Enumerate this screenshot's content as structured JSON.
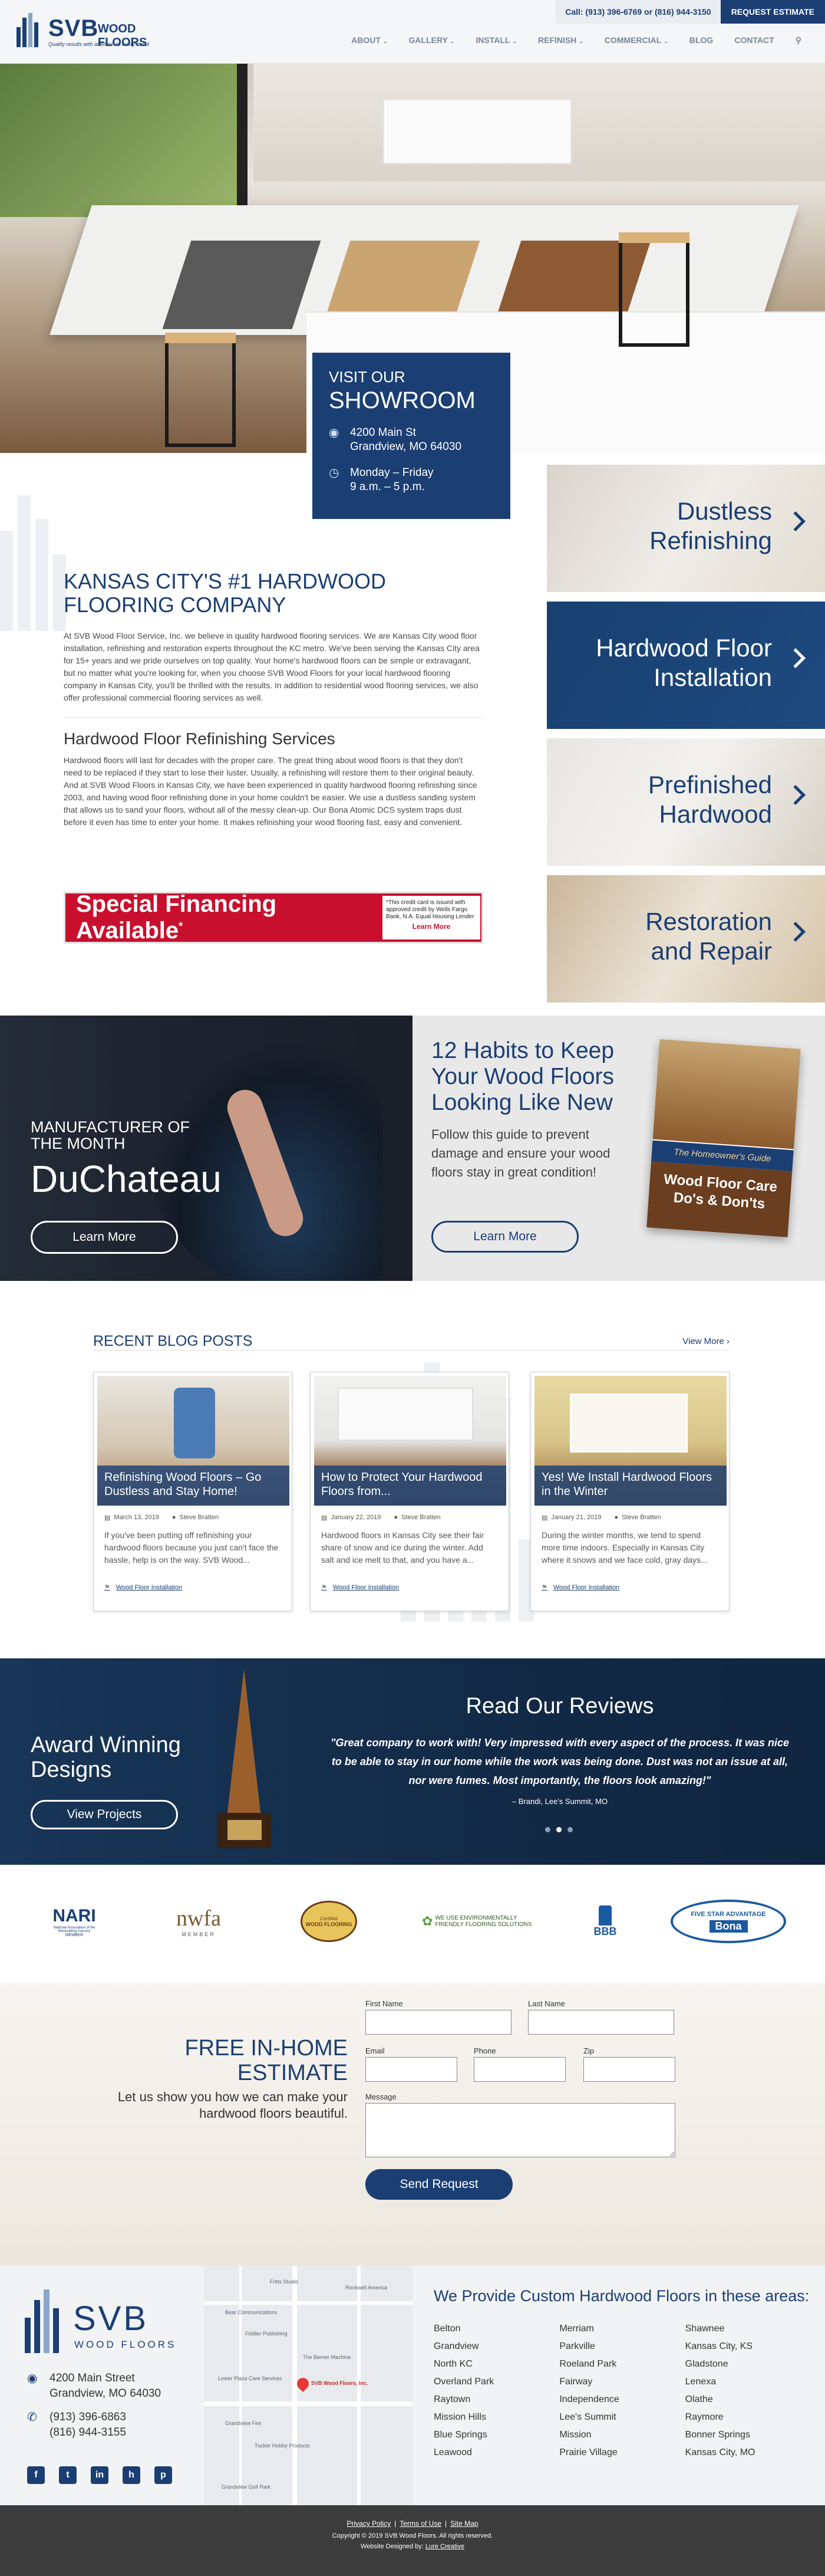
{
  "header": {
    "logo_brand": "SVB",
    "logo_brand2": "WOOD FLOORS",
    "logo_tagline": "Quality results with attention to every detail",
    "phone": "Call: (913) 396-6769 or (816) 944-3150",
    "request_button": "REQUEST ESTIMATE",
    "nav": [
      "ABOUT",
      "GALLERY",
      "INSTALL",
      "REFINISH",
      "COMMERCIAL",
      "BLOG",
      "CONTACT"
    ],
    "nav_dropdowns": [
      true,
      true,
      true,
      true,
      true,
      false,
      false
    ]
  },
  "showroom": {
    "visit": "VISIT OUR",
    "title": "SHOWROOM",
    "address_1": "4200 Main St",
    "address_2": "Grandview, MO 64030",
    "hours_1": "Monday – Friday",
    "hours_2": "9 a.m. – 5 p.m."
  },
  "services": [
    {
      "line1": "Dustless",
      "line2": "Refinishing",
      "color": "#1b3f73"
    },
    {
      "line1": "Hardwood Floor",
      "line2": "Installation",
      "color": "#ffffff"
    },
    {
      "line1": "Prefinished",
      "line2": "Hardwood",
      "color": "#1b3f73"
    },
    {
      "line1": "Restoration",
      "line2": "and Repair",
      "color": "#1b3f73"
    }
  ],
  "intro": {
    "title": "KANSAS CITY'S #1 HARDWOOD FLOORING COMPANY",
    "body": "At SVB Wood Floor Service, Inc. we believe in quality hardwood flooring services. We are Kansas City wood floor installation, refinishing and restoration experts throughout the KC metro. We've been serving the Kansas City area for 15+ years and we pride ourselves on top quality. Your home's hardwood floors can be simple or extravagant, but no matter what you're looking for, when you choose SVB Wood Floors for your local hardwood flooring company in Kansas City, you'll be thrilled with the results. In addition to residential wood flooring services, we also offer professional commercial flooring services as well.",
    "subtitle": "Hardwood Floor Refinishing Services",
    "body2": "Hardwood floors will last for decades with the proper care. The great thing about wood floors is that they don't need to be replaced if they start to lose their luster. Usually, a refinishing will restore them to their original beauty. And at SVB Wood Floors in Kansas City, we have been experienced in quality hardwood flooring refinishing since 2003, and having wood floor refinishing done in your home couldn't be easier. We use a dustless sanding system that allows us to sand your floors, without all of the messy clean-up. Our Bona Atomic DCS system traps dust before it even has time to enter your home. It makes refinishing your wood flooring fast, easy and convenient."
  },
  "financing": {
    "title": "Special Financing Available",
    "sup": "*",
    "fine": "*This credit card is issued with approved credit by Wells Fargo Bank, N.A. Equal Housing Lender",
    "link": "Learn More"
  },
  "duchateau": {
    "label": "MANUFACTURER OF THE MONTH",
    "brand": "DuChateau",
    "button": "Learn More"
  },
  "habits": {
    "title": "12 Habits to Keep Your Wood Floors Looking Like New",
    "text": "Follow this guide to prevent damage and ensure your wood floors stay in great condition!",
    "button": "Learn More",
    "book_top": "The Homeowner's Guide",
    "book_title": "Wood Floor Care Do's & Don'ts"
  },
  "blog": {
    "title": "RECENT BLOG POSTS",
    "view_more": "View More ›",
    "posts": [
      {
        "title": "Refinishing Wood Floors – Go Dustless and Stay Home!",
        "date": "March 13, 2019",
        "author": "Steve Bratten",
        "excerpt": "If you've been putting off refinishing your hardwood floors because you just can't face the hassle, help is on the way. SVB Wood...",
        "tag": "Wood Floor Installation"
      },
      {
        "title": "How to Protect Your Hardwood Floors from...",
        "date": "January 22, 2019",
        "author": "Steve Bratten",
        "excerpt": "Hardwood floors in Kansas City see their fair share of snow and ice during the winter. Add salt and ice melt to that, and you have a...",
        "tag": "Wood Floor Installation"
      },
      {
        "title": "Yes! We Install Hardwood Floors in the Winter",
        "date": "January 21, 2019",
        "author": "Steve Bratten",
        "excerpt": "During the winter months, we tend to spend more time indoors. Especially in Kansas City where it snows and we face cold, gray days...",
        "tag": "Wood Floor Installation"
      }
    ]
  },
  "award": {
    "title": "Award Winning Designs",
    "button": "View Projects"
  },
  "reviews": {
    "title": "Read Our Reviews",
    "quote": "\"Great company to work with! Very impressed with every aspect of the process. It was nice to be able to stay in our home while the work was being done. Dust was not an issue at all, nor were fumes. Most importantly, the floors look amazing!\"",
    "author": "– Brandi, Lee's Summit, MO",
    "active_dot": 1
  },
  "logos": [
    {
      "name": "NARI",
      "sub": "National Association of the Remodeling Industry",
      "sub2": "MEMBER"
    },
    {
      "name": "nwfa",
      "sub": "MEMBER"
    },
    {
      "name": "WOOD FLOORING",
      "sub": "Certified"
    },
    {
      "name": "WE USE ENVIRONMENTALLY FRIENDLY FLOORING SOLUTIONS"
    },
    {
      "name": "BBB"
    },
    {
      "name": "FIVE STAR ADVANTAGE",
      "sub": "Bona"
    }
  ],
  "estimate": {
    "title": "FREE IN-HOME ESTIMATE",
    "subtitle": "Let us show you how we can make your hardwood floors beautiful.",
    "labels": {
      "first": "First Name",
      "last": "Last Name",
      "email": "Email",
      "phone": "Phone",
      "zip": "Zip",
      "message": "Message"
    },
    "button": "Send Request"
  },
  "footer": {
    "logo_brand": "SVB",
    "logo_sub": "WOOD FLOORS",
    "address_1": "4200 Main Street",
    "address_2": "Grandview, MO 64030",
    "phone_1": "(913) 396-6863",
    "phone_2": "(816) 944-3155",
    "social": [
      "f",
      "t",
      "in",
      "h",
      "p"
    ],
    "social_icons": [
      "facebook-icon",
      "twitter-icon",
      "linkedin-icon",
      "houzz-icon",
      "pinterest-icon"
    ],
    "areas_title": "We Provide Custom Hardwood Floors in these areas:",
    "areas": [
      [
        "Belton",
        "Grandview",
        "North KC",
        "Overland Park",
        "Raytown",
        "Mission Hills",
        "Blue Springs",
        "Leawood"
      ],
      [
        "Merriam",
        "Parkville",
        "Roeland Park",
        "Fairway",
        "Independence",
        "Lee's Summit",
        "Mission",
        "Prairie Village"
      ],
      [
        "Shawnee",
        "Kansas City, KS",
        "Gladstone",
        "Lenexa",
        "Olathe",
        "Raymore",
        "Bonner Springs",
        "Kansas City, MO"
      ]
    ],
    "map_labels": [
      "Fritts Studio",
      "Rockwell America",
      "Bear Communications",
      "Fiddler Publishing",
      "SVB Wood Floors, Inc.",
      "The Berner Machine",
      "Lower Plaza Care Services",
      "Grandview Fire",
      "Tucker Hobby Products",
      "Grandview Golf Park"
    ]
  },
  "bottom": {
    "links": [
      "Privacy Policy",
      "Terms of Use",
      "Site Map"
    ],
    "copyright": "Copyright © 2019 SVB Wood Floors. All rights reserved.",
    "designed_prefix": "Website Designed by: ",
    "designer": "Lure Creative"
  },
  "colors": {
    "brand": "#1b3f73",
    "finance_red": "#c8102e"
  }
}
